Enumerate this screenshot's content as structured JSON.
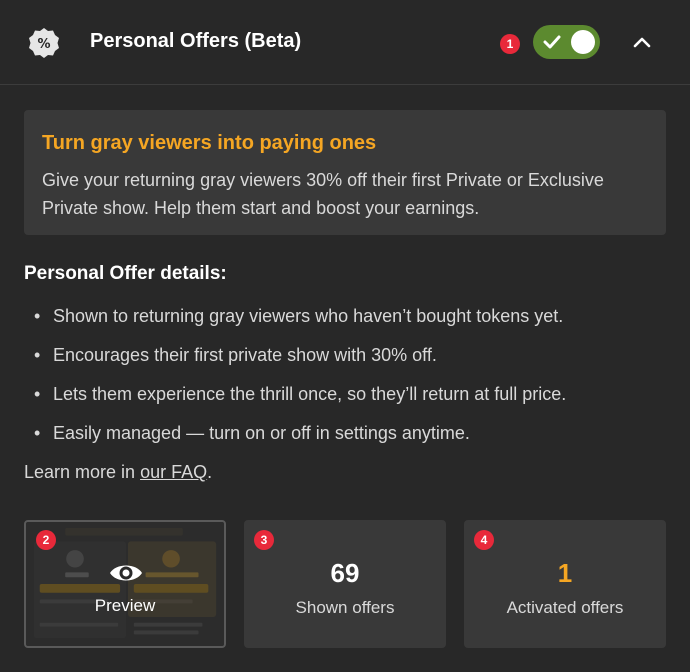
{
  "header": {
    "title": "Personal Offers (Beta)",
    "logo_icon": "percent-badge-icon",
    "badge": "1",
    "toggle_on": true,
    "toggle_color": "#5c8a2f",
    "collapse_icon": "chevron-up-icon"
  },
  "promo": {
    "title": "Turn gray viewers into paying ones",
    "text": "Give your returning gray viewers 30% off their first Private or Exclusive Private show. Help them start and boost your earnings.",
    "title_color": "#f5a623"
  },
  "details": {
    "title": "Personal Offer details:",
    "items": [
      "Shown to returning gray viewers who haven’t bought tokens yet.",
      "Encourages their first private show with 30% off.",
      "Lets them experience the thrill once, so they’ll return at full price.",
      "Easily managed — turn on or off in settings anytime."
    ]
  },
  "learn_more": {
    "prefix": "Learn more in ",
    "link": "our FAQ",
    "suffix": "."
  },
  "cards": {
    "preview": {
      "badge": "2",
      "label": "Preview",
      "icon": "eye-icon"
    },
    "shown": {
      "badge": "3",
      "value": "69",
      "label": "Shown offers",
      "value_color": "#ffffff"
    },
    "activated": {
      "badge": "4",
      "value": "1",
      "label": "Activated offers",
      "value_color": "#f5a623"
    }
  }
}
